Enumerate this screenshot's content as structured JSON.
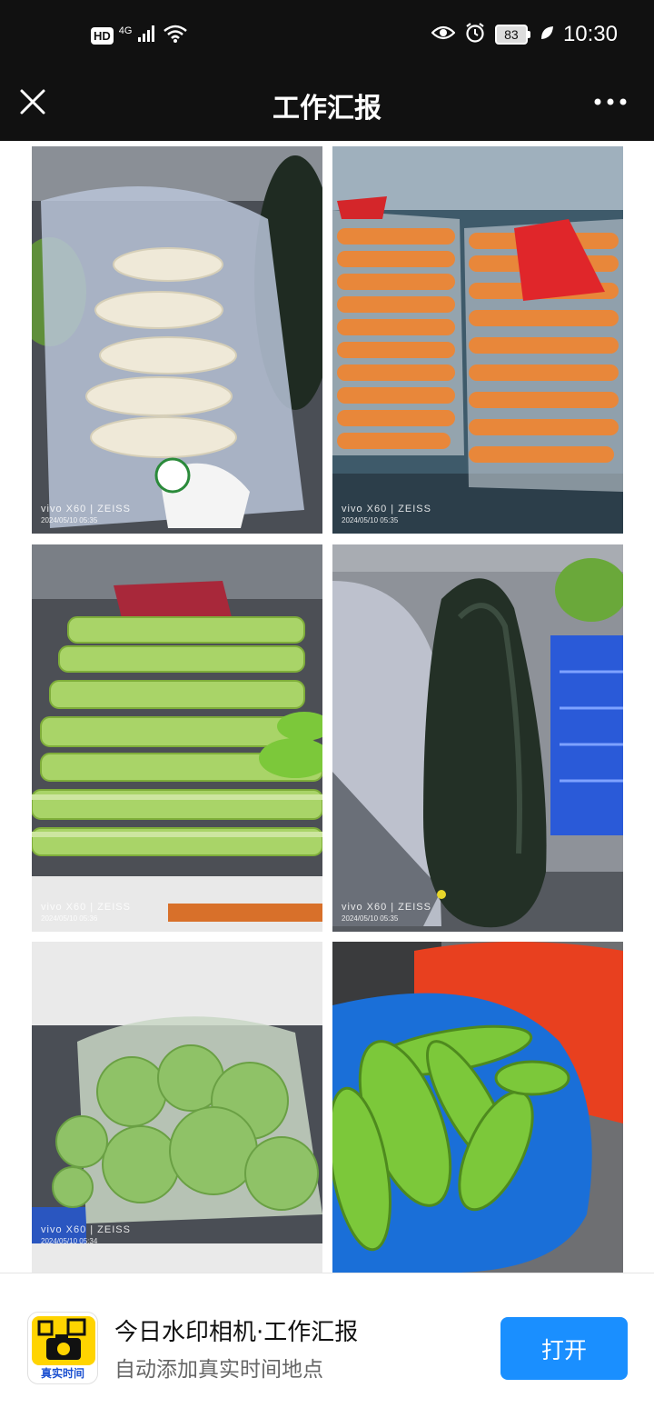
{
  "status_bar": {
    "hd_badge": "HD",
    "network": "4G",
    "battery": "83",
    "time": "10:30"
  },
  "nav": {
    "title": "工作汇报"
  },
  "photos": [
    {
      "caption_brand": "vivo X60 | ZEISS",
      "caption_date": "2024/05/10 05:35"
    },
    {
      "caption_brand": "vivo X60 | ZEISS",
      "caption_date": "2024/05/10 05:35"
    },
    {
      "caption_brand": "vivo X60 | ZEISS",
      "caption_date": "2024/05/10 05:36"
    },
    {
      "caption_brand": "vivo X60 | ZEISS",
      "caption_date": "2024/05/10 05:35"
    },
    {
      "caption_brand": "vivo X60 | ZEISS",
      "caption_date": "2024/05/10 05:34"
    }
  ],
  "banner": {
    "app_name": "今日水印相机·工作汇报",
    "app_desc": "自动添加真实时间地点",
    "icon_label": "真实时间",
    "open_label": "打开"
  },
  "colors": {
    "bar_bg": "#111111",
    "open_button": "#1a8fff",
    "icon_yellow": "#ffd400"
  }
}
